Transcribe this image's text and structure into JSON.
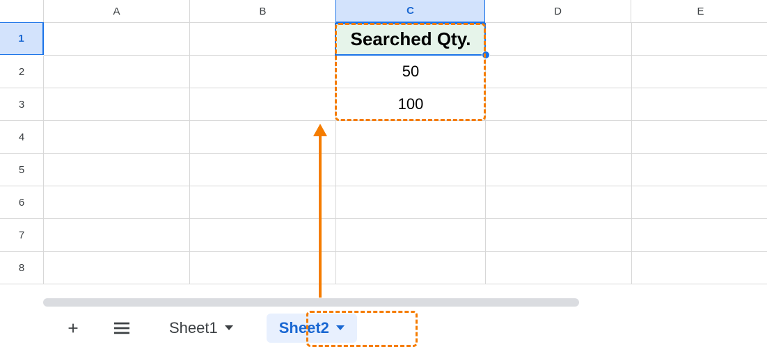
{
  "columns": {
    "A": "A",
    "B": "B",
    "C": "C",
    "D": "D",
    "E": "E"
  },
  "row_labels": [
    "1",
    "2",
    "3",
    "4",
    "5",
    "6",
    "7",
    "8"
  ],
  "selected_cell_ref": "C1",
  "cells": {
    "C1": "Searched Qty.",
    "C2": "50",
    "C3": "100"
  },
  "tabs": {
    "sheet1": "Sheet1",
    "sheet2": "Sheet2",
    "active": "Sheet2"
  },
  "annotations": {
    "highlight_cells": "C1:C3",
    "highlight_tab": "Sheet2"
  }
}
